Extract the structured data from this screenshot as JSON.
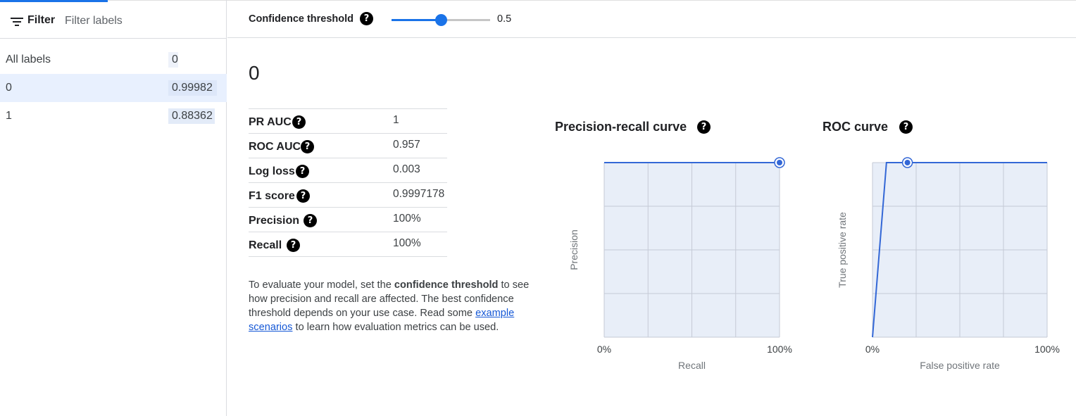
{
  "filter": {
    "label": "Filter",
    "placeholder": "Filter labels"
  },
  "labels": [
    {
      "name": "All labels",
      "value": "0"
    },
    {
      "name": "0",
      "value": "0.99982"
    },
    {
      "name": "1",
      "value": "0.88362"
    }
  ],
  "selected_label_index": 1,
  "header": {
    "confidence_label": "Confidence threshold",
    "threshold_value": "0.5",
    "slider_min": 0,
    "slider_max": 1,
    "slider_value": 0.5
  },
  "main": {
    "title": "0",
    "metrics": [
      {
        "name": "PR AUC",
        "value": "1"
      },
      {
        "name": "ROC AUC",
        "value": "0.957"
      },
      {
        "name": "Log loss",
        "value": "0.003"
      },
      {
        "name": "F1 score",
        "value": "0.9997178"
      },
      {
        "name": "Precision",
        "value": "100%"
      },
      {
        "name": "Recall",
        "value": "100%"
      }
    ],
    "description": {
      "part1": "To evaluate your model, set the ",
      "bold": "confidence threshold",
      "part2": " to see how precision and recall are affected. The best confidence threshold depends on your use case. Read some ",
      "link": "example scenarios",
      "part3": " to learn how evaluation metrics can be used."
    }
  },
  "help_glyph": "?",
  "colors": {
    "accent": "#1a73e8",
    "chart_line": "#3367d6",
    "chart_fill": "#e8eef8",
    "grid": "#c5cad6",
    "selected_row": "#e8f0fe"
  },
  "chart_data": [
    {
      "type": "area",
      "title": "Precision-recall curve",
      "xlabel": "Recall",
      "ylabel": "Precision",
      "x_tick_labels": [
        "0%",
        "100%"
      ],
      "xlim": [
        0,
        1
      ],
      "ylim": [
        0,
        1
      ],
      "grid": true,
      "points": [
        [
          0,
          1
        ],
        [
          1,
          1
        ]
      ],
      "marker": [
        1,
        1
      ]
    },
    {
      "type": "area",
      "title": "ROC curve",
      "xlabel": "False positive rate",
      "ylabel": "True positive rate",
      "x_tick_labels": [
        "0%",
        "100%"
      ],
      "xlim": [
        0,
        1
      ],
      "ylim": [
        0,
        1
      ],
      "grid": true,
      "points": [
        [
          0,
          0
        ],
        [
          0.08,
          1
        ],
        [
          1,
          1
        ]
      ],
      "marker": [
        0.2,
        1
      ]
    }
  ]
}
